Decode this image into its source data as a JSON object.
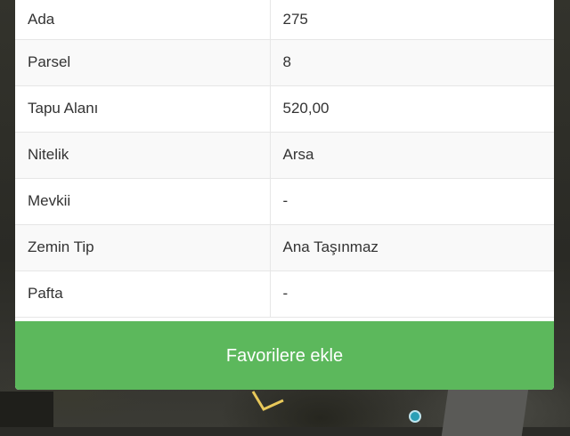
{
  "parcel_info": {
    "rows": [
      {
        "label": "Ada",
        "value": "275"
      },
      {
        "label": "Parsel",
        "value": "8"
      },
      {
        "label": "Tapu Alanı",
        "value": "520,00"
      },
      {
        "label": "Nitelik",
        "value": "Arsa"
      },
      {
        "label": "Mevkii",
        "value": "-"
      },
      {
        "label": "Zemin Tip",
        "value": "Ana Taşınmaz"
      },
      {
        "label": "Pafta",
        "value": "-"
      }
    ]
  },
  "actions": {
    "favorite_label": "Favorilere ekle"
  },
  "colors": {
    "button_green": "#5cb85c",
    "location_dot": "#2a9fb6",
    "parcel_outline": "#e8c85a"
  },
  "icons": {
    "map_marker": "location-dot-icon"
  }
}
